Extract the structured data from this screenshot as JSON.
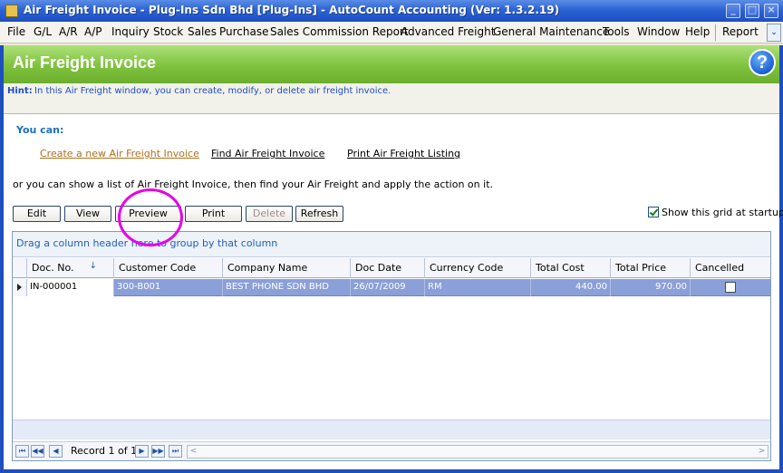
{
  "window": {
    "title": "Air Freight Invoice - Plug-Ins Sdn Bhd [Plug-Ins] - AutoCount Accounting (Ver: 1.3.2.19)",
    "minimize_glyph": "_",
    "maximize_glyph": "□",
    "close_glyph": "×"
  },
  "menu": {
    "items": [
      "File",
      "G/L",
      "A/R",
      "A/P",
      "Inquiry",
      "Stock",
      "Sales",
      "Purchase",
      "Sales Commission Report",
      "Advanced Freight",
      "General Maintenance",
      "Tools",
      "Window",
      "Help",
      "Report"
    ],
    "overflow_glyph": "⌄"
  },
  "banner": {
    "title": "Air Freight Invoice",
    "help_glyph": "?"
  },
  "hint": {
    "label": "Hint:",
    "text": "In this Air Freight window, you can create, modify, or delete air freight invoice."
  },
  "content": {
    "you_can": "You can:",
    "links": {
      "create": "Create a new Air Freight Invoice",
      "find": "Find Air Freight Invoice",
      "print": "Print Air Freight Listing"
    },
    "or_text": "or you can show a list of Air Freight Invoice, then find your Air Freight and apply the action on it.",
    "buttons": {
      "edit": "Edit",
      "view": "View",
      "preview": "Preview",
      "print": "Print",
      "delete": "Delete",
      "refresh": "Refresh"
    },
    "show_grid_label": "Show this grid at startup",
    "show_grid_checked": true
  },
  "grid": {
    "group_hint": "Drag a column header here to group by that column",
    "sort_icon": "↓",
    "columns": [
      "Doc. No.",
      "Customer Code",
      "Company Name",
      "Doc Date",
      "Currency Code",
      "Total Cost",
      "Total Price",
      "Cancelled"
    ],
    "rows": [
      {
        "doc_no": "IN-000001",
        "customer_code": "300-B001",
        "company_name": "BEST PHONE SDN BHD",
        "doc_date": "26/07/2009",
        "currency_code": "RM",
        "total_cost": "440.00",
        "total_price": "970.00",
        "cancelled": false
      }
    ],
    "navigator": {
      "record_text": "Record 1 of 1",
      "first": "⏮",
      "prev_page": "◀◀",
      "prev": "◀",
      "next": "▶",
      "next_page": "▶▶",
      "last": "⏭",
      "scroll_left": "<",
      "scroll_right": ">"
    }
  },
  "colors": {
    "title_bar": "#2d63d4",
    "banner": "#7ec23d",
    "highlight_circle": "#e600e6",
    "selected_row": "#8b9fd8",
    "hint_text": "#1d4fbf"
  }
}
